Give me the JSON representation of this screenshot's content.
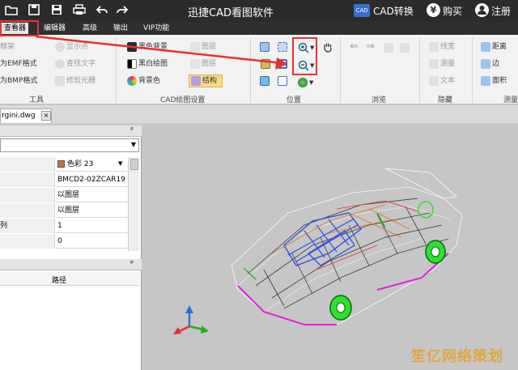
{
  "titlebar": {
    "app_title": "迅捷CAD看图软件",
    "cad_badge": "CAD",
    "convert_label": "CAD转换",
    "buy_icon": "¥",
    "buy_label": "购买",
    "register_label": "注册",
    "icons": [
      "folder-icon",
      "save-icon",
      "save-as-icon",
      "print-icon",
      "undo-icon",
      "redo-icon",
      "user-icon"
    ]
  },
  "menu": {
    "items": [
      "查看器",
      "编辑器",
      "高级",
      "输出",
      "VIP功能"
    ],
    "active": "查看器"
  },
  "ribbon": {
    "tools": {
      "items": [
        "框架",
        "为EMF格式",
        "为BMP格式"
      ],
      "label": "工具"
    },
    "show": {
      "items": [
        "显示点",
        "查找文字",
        "修剪光栅"
      ]
    },
    "settings": {
      "items": [
        "黑色背景",
        "黑白绘图",
        "背景色",
        "图层",
        "图层",
        "结构"
      ],
      "label": "CAD绘图设置"
    },
    "position": {
      "label": "位置"
    },
    "browse": {
      "label": "浏览"
    },
    "hide": {
      "items": [
        "线宽",
        "测量",
        "文本"
      ],
      "label": "隐藏"
    },
    "measure": {
      "items": [
        "距离",
        "边",
        "面积"
      ],
      "label": "测量"
    }
  },
  "document_tab": {
    "name": "rgini.dwg",
    "close": "×"
  },
  "properties_panel": {
    "pin": "ᵖ",
    "rows": [
      {
        "key": "",
        "value": "色彩 23"
      },
      {
        "key": "",
        "value": "BMCD2-02ZCAR19"
      },
      {
        "key": "",
        "value": "以图层"
      },
      {
        "key": "",
        "value": "以图层"
      },
      {
        "key": "列",
        "value": "1"
      },
      {
        "key": "",
        "value": "0"
      }
    ],
    "color_swatch": "#c46f4a"
  },
  "layers_panel": {
    "pin": "ᵖ",
    "column_header": "路径"
  },
  "watermark": "笙亿网络策划"
}
